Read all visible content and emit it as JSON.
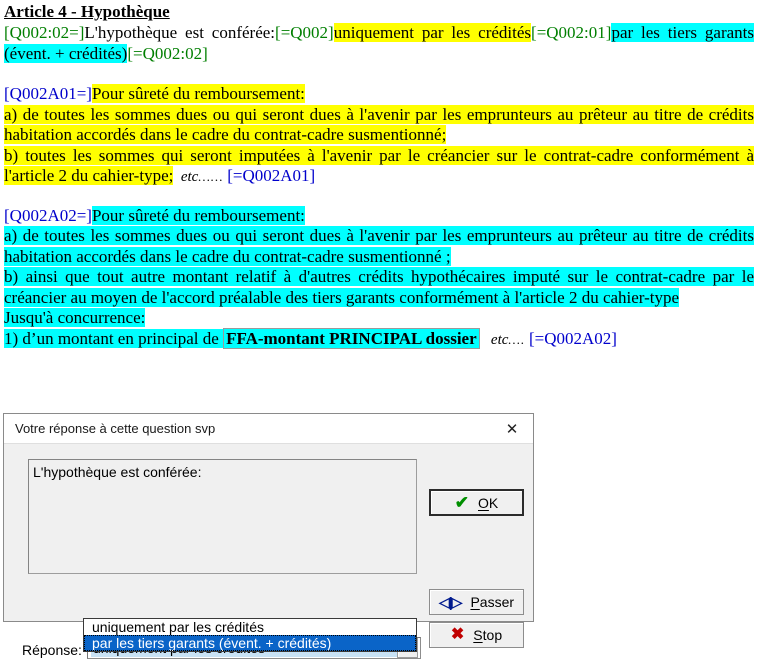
{
  "document": {
    "title": "Article 4 - Hypothèque",
    "block1": {
      "code_open": "[Q002:02=]",
      "text_plain": "L'hypothèque est conférée:",
      "code_mid1": "[=Q002]",
      "highlight_yellow": "uniquement par les crédités",
      "code_mid2": "[=Q002:01]",
      "highlight_cyan": "par les tiers garants (évent. + crédités)",
      "code_close": "[=Q002:02]"
    },
    "block2": {
      "code_open": "[Q002A01=]",
      "line1": "Pour sûreté du remboursement:",
      "line2": "a) de toutes les sommes dues ou qui seront dues à l'avenir par les emprunteurs au prêteur au titre de crédits habitation accordés dans le cadre du contrat-cadre susmentionné;",
      "line3": "b) toutes les sommes qui seront imputées à l'avenir par le créancier sur le contrat-cadre conformément à l'article 2 du cahier-type;",
      "etc": "etc",
      "etc_dots": "……",
      "code_close": "[=Q002A01]"
    },
    "block3": {
      "code_open": "[Q002A02=]",
      "line1": "Pour sûreté du remboursement:",
      "line2": "a) de toutes les sommes dues ou qui seront dues à l'avenir par les emprunteurs au prêteur au titre de crédits habitation accordés dans le cadre du contrat-cadre susmentionné ;",
      "line3": "b) ainsi que tout autre montant relatif à d'autres crédits hypothécaires imputé sur le contrat-cadre par le créancier au moyen de l'accord préalable des tiers garants conformément à l'article 2 du cahier-type",
      "line4": "Jusqu'à concurrence:",
      "line5_prefix": "1) d’un montant en principal de ",
      "field_token": "FFA-montant PRINCIPAL dossier",
      "etc": "etc",
      "etc_dots": "….",
      "code_close": "[=Q002A02]"
    }
  },
  "dialog": {
    "title": "Votre réponse à cette question svp",
    "close_icon": "✕",
    "question_text": "L'hypothèque est conférée:",
    "buttons": {
      "ok": {
        "label": "OK",
        "underline_char": "O",
        "icon": "check-icon",
        "glyph": "✔"
      },
      "passer": {
        "label": "Passer",
        "underline_char": "P",
        "icon": "skip-icon",
        "glyph": "◁|▷"
      },
      "stop": {
        "label": "Stop",
        "underline_char": "S",
        "icon": "cross-icon",
        "glyph": "✖"
      }
    },
    "response_label": "Réponse:",
    "combo": {
      "selected_value": "uniquement par les crédités",
      "arrow_glyph": "▼",
      "options": [
        {
          "label": "uniquement par les crédités",
          "selected": false
        },
        {
          "label": "par les tiers garants (évent. + crédités)",
          "selected": true
        }
      ]
    }
  },
  "colors": {
    "highlight_yellow": "#ffff00",
    "highlight_cyan": "#00ffff",
    "code_green": "#007f00",
    "code_blue": "#0000cc",
    "selection_blue": "#0a64c8",
    "check_green": "#008f00",
    "stop_red": "#c00000"
  }
}
